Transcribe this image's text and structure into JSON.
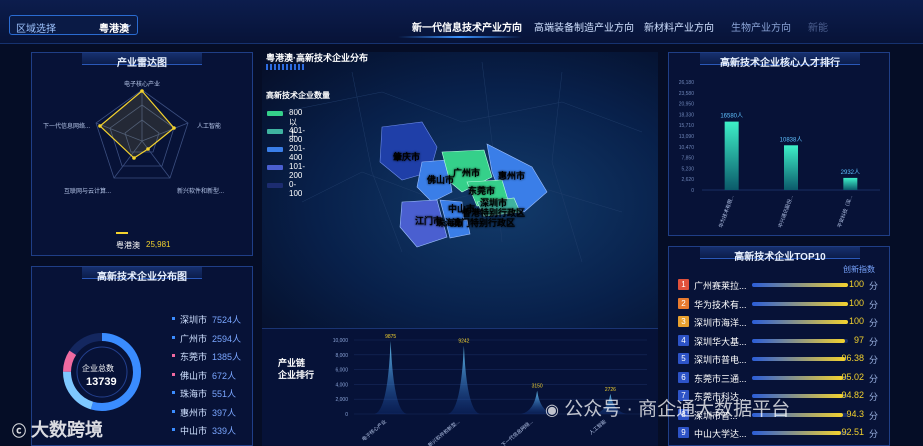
{
  "header": {
    "region_label": "区域选择",
    "region_value": "粤港澳",
    "tabs": [
      "新一代信息技术产业方向",
      "高端装备制造产业方向",
      "新材料产业方向",
      "生物产业方向",
      "新能"
    ]
  },
  "radar": {
    "title": "产业雷达图",
    "axes": [
      "电子核心产业",
      "人工智能",
      "新兴软件和新型...",
      "互联网与云计算...",
      "下一代信息网络..."
    ],
    "legend_name": "粤港澳",
    "legend_value": "25,981"
  },
  "distribution": {
    "title": "高新技术企业分布图",
    "total_label": "企业总数",
    "total_value": "13739",
    "items": [
      {
        "city": "深圳市",
        "value": "7524人",
        "color": "#3b8cff"
      },
      {
        "city": "广州市",
        "value": "2594人",
        "color": "#3b8cff"
      },
      {
        "city": "东莞市",
        "value": "1385人",
        "color": "#f06aa0"
      },
      {
        "city": "佛山市",
        "value": "672人",
        "color": "#f06aa0"
      },
      {
        "city": "珠海市",
        "value": "551人",
        "color": "#3b8cff"
      },
      {
        "city": "惠州市",
        "value": "397人",
        "color": "#3b8cff"
      },
      {
        "city": "中山市",
        "value": "339人",
        "color": "#3b8cff"
      }
    ]
  },
  "map": {
    "title": "粤港澳·高新技术企业分布",
    "legend_title": "高新技术企业数量",
    "legend": [
      {
        "label": "800以上",
        "color": "#35d08a"
      },
      {
        "label": "401-800",
        "color": "#3fb3a0"
      },
      {
        "label": "201-400",
        "color": "#3a7ee8"
      },
      {
        "label": "101-200",
        "color": "#4a5fd0"
      },
      {
        "label": "0-100",
        "color": "#1c2c70"
      }
    ],
    "cities": [
      "肇庆市",
      "佛山市",
      "广州市",
      "东莞市",
      "惠州市",
      "深圳市",
      "中山市",
      "江门市",
      "珠海市",
      "香港特别行政区",
      "澳门特别行政区"
    ]
  },
  "chain": {
    "title_line1": "产业链",
    "title_line2": "企业排行",
    "chart_data": {
      "type": "area",
      "categories": [
        "电子核心产业",
        "新兴软件和新型...",
        "下一代信息网络...",
        "人工智能"
      ],
      "values": [
        9875,
        9242,
        3150,
        2726
      ],
      "ylim": [
        0,
        10000
      ],
      "yticks": [
        "10,000",
        "8,000",
        "6,000",
        "4,000",
        "2,000",
        "0"
      ]
    }
  },
  "talent": {
    "title": "高新技术企业核心人才排行",
    "chart_data": {
      "type": "bar",
      "categories": [
        "华为技术有限...",
        "中兴通讯股份...",
        "平安科技（深..."
      ],
      "values": [
        16580,
        10838,
        2932
      ],
      "value_labels": [
        "16580人",
        "10838人",
        "2932人"
      ],
      "ylim": [
        0,
        26180
      ],
      "yticks": [
        "26,180",
        "23,580",
        "20,950",
        "18,330",
        "15,710",
        "13,090",
        "10,470",
        "7,850",
        "5,230",
        "2,620",
        "0"
      ]
    }
  },
  "top10": {
    "title": "高新技术企业TOP10",
    "col_header": "创新指数",
    "unit": "分",
    "rows": [
      {
        "rank": "1",
        "name": "广州赛莱拉...",
        "score": "100",
        "pct": 1.0,
        "color": "#e0513c"
      },
      {
        "rank": "2",
        "name": "华为技术有...",
        "score": "100",
        "pct": 1.0,
        "color": "#e87a2f"
      },
      {
        "rank": "3",
        "name": "深圳市海洋...",
        "score": "100",
        "pct": 1.0,
        "color": "#e8a02f"
      },
      {
        "rank": "4",
        "name": "深圳华大基...",
        "score": "97",
        "pct": 0.97,
        "color": "#2d53c7"
      },
      {
        "rank": "5",
        "name": "深圳市普电...",
        "score": "96.38",
        "pct": 0.9638,
        "color": "#2d53c7"
      },
      {
        "rank": "6",
        "name": "东莞市三通...",
        "score": "95.02",
        "pct": 0.9502,
        "color": "#2d53c7"
      },
      {
        "rank": "7",
        "name": "东莞市科达...",
        "score": "94.82",
        "pct": 0.9482,
        "color": "#2d53c7"
      },
      {
        "rank": "8",
        "name": "深圳市普...",
        "score": "94.3",
        "pct": 0.943,
        "color": "#2d53c7"
      },
      {
        "rank": "9",
        "name": "中山大学达...",
        "score": "92.51",
        "pct": 0.9251,
        "color": "#2d53c7"
      }
    ]
  },
  "watermarks": {
    "left": "大数跨境",
    "right": "公众号 · 商企通大数据平台"
  }
}
